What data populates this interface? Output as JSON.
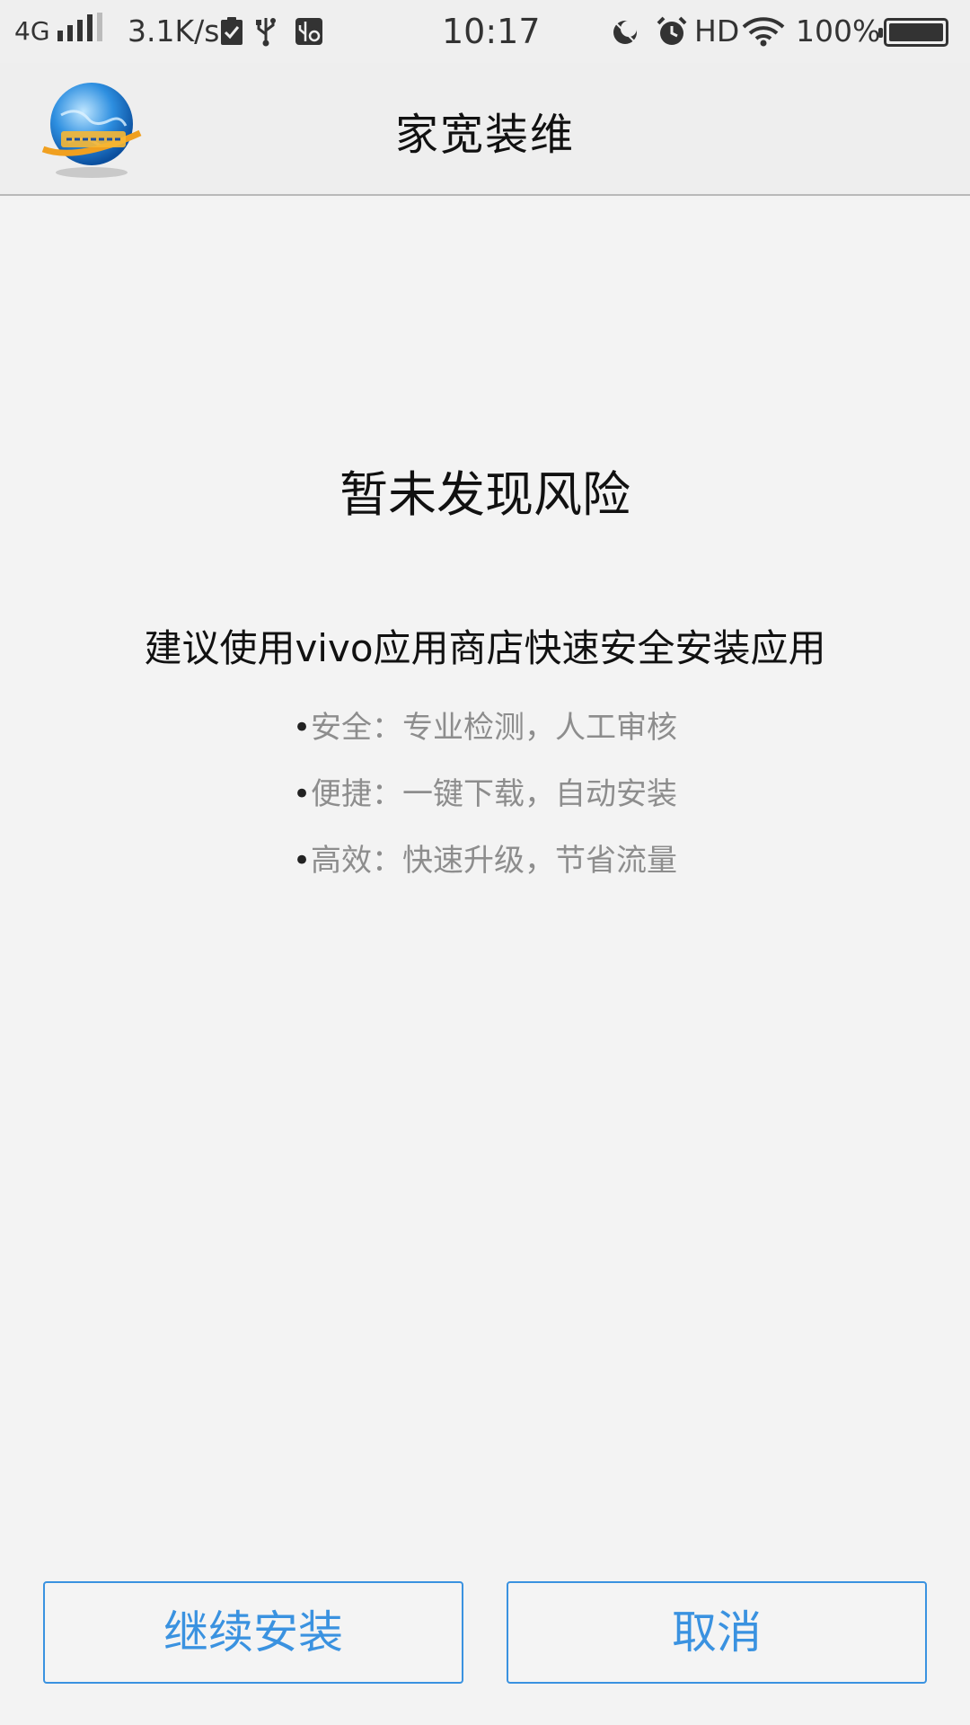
{
  "status_bar": {
    "network_type": "4G",
    "net_speed": "3.1K/s",
    "time": "10:17",
    "hd": "HD",
    "battery": "100%",
    "icons": [
      "signal-icon",
      "check-notification-icon",
      "usb-icon",
      "usb-debug-icon",
      "do-not-disturb-icon",
      "alarm-icon",
      "wifi-icon",
      "battery-icon"
    ]
  },
  "header": {
    "title": "家宽装维",
    "logo_icon": "globe-logo-icon"
  },
  "main": {
    "result_title": "暂未发现风险",
    "recommend_text": "建议使用vivo应用商店快速安全安装应用",
    "benefits": [
      {
        "bullet": "•",
        "text": "安全：专业检测，人工审核"
      },
      {
        "bullet": "•",
        "text": "便捷：一键下载，自动安装"
      },
      {
        "bullet": "•",
        "text": "高效：快速升级，节省流量"
      }
    ]
  },
  "actions": {
    "continue_label": "继续安装",
    "cancel_label": "取消"
  },
  "colors": {
    "accent": "#3a92e0",
    "background": "#f3f3f3",
    "secondary_text": "#8d8d8d"
  }
}
